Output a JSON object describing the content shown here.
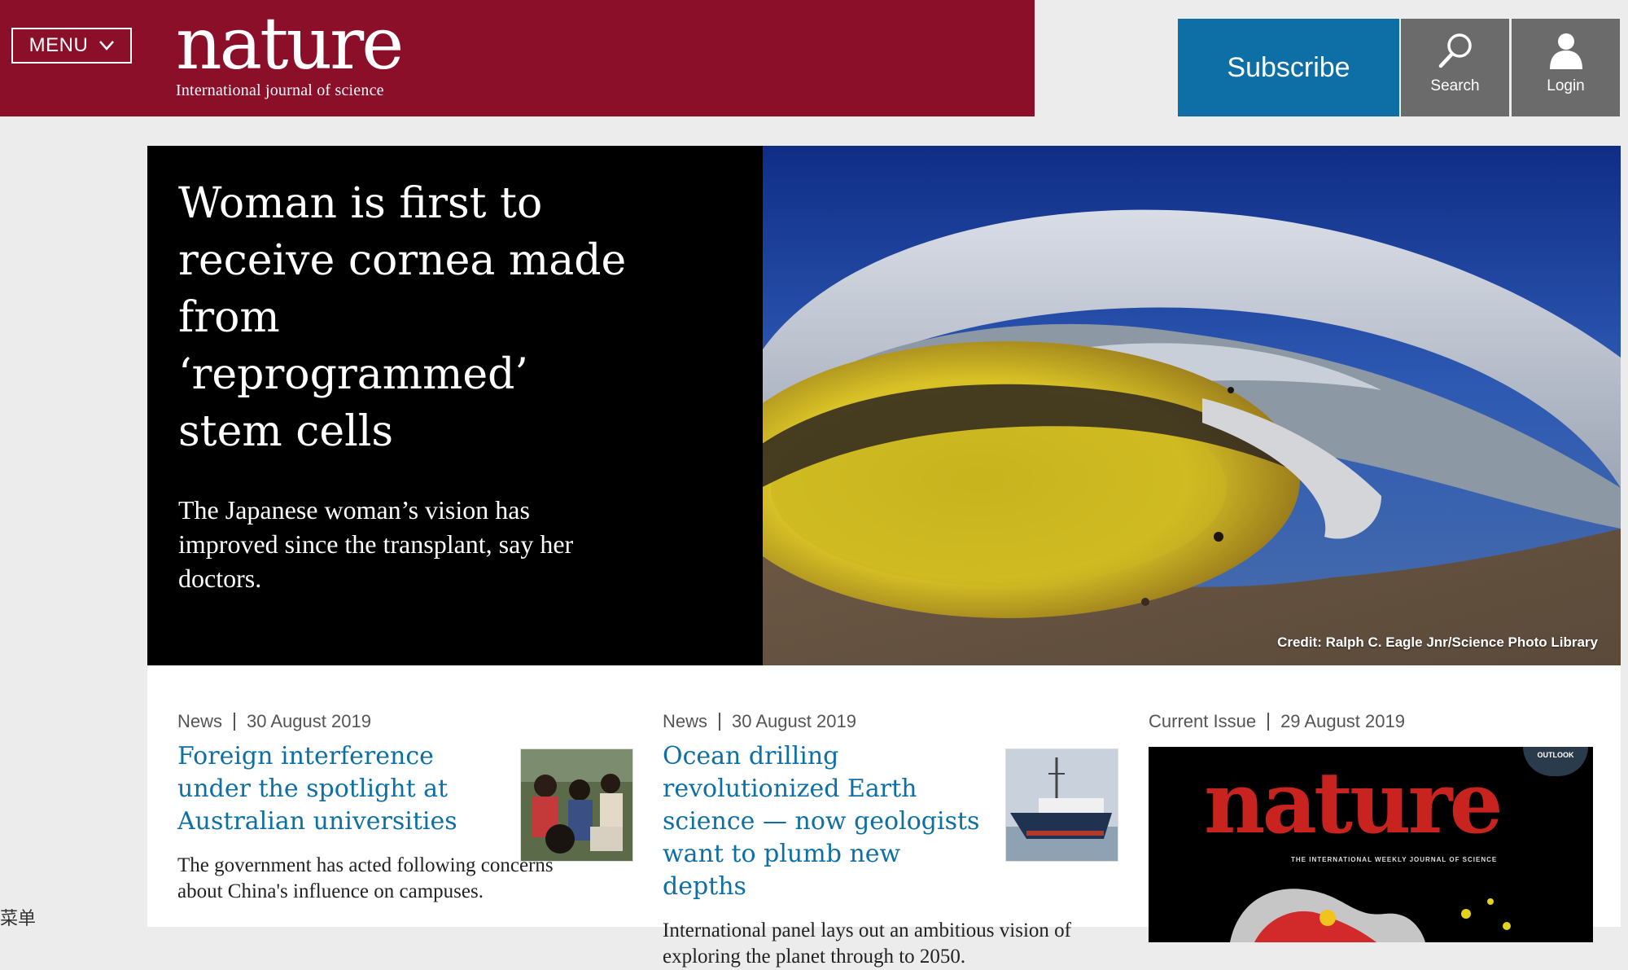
{
  "header": {
    "menu_label": "MENU",
    "logo_wordmark": "nature",
    "logo_tagline": "International journal of science",
    "subscribe_label": "Subscribe",
    "search_label": "Search",
    "login_label": "Login",
    "colors": {
      "brand": "#8c0f2a",
      "subscribe": "#0e6fa6",
      "tool": "#6b6b6b"
    }
  },
  "hero": {
    "title": "Woman is first to receive cornea made from ‘reprogrammed’ stem cells",
    "summary": "The Japanese woman’s vision has improved since the transplant, say her doctors.",
    "credit": "Credit: Ralph C. Eagle Jnr/Science Photo Library"
  },
  "cards": [
    {
      "type": "News",
      "date": "30 August 2019",
      "title": "Foreign interference under the spotlight at Australian universities",
      "summary": "The government has acted following concerns about China's influence on campuses."
    },
    {
      "type": "News",
      "date": "30 August 2019",
      "title": "Ocean drilling revolutionized Earth science — now geologists want to plumb new depths",
      "summary": "International panel lays out an ambitious vision of exploring the planet through to 2050."
    },
    {
      "type": "Current Issue",
      "date": "29 August 2019",
      "cover_masthead": "nature",
      "cover_subtitle": "THE INTERNATIONAL WEEKLY JOURNAL OF SCIENCE",
      "cover_badge": "OUTLOOK"
    }
  ],
  "corner_text": "菜单"
}
